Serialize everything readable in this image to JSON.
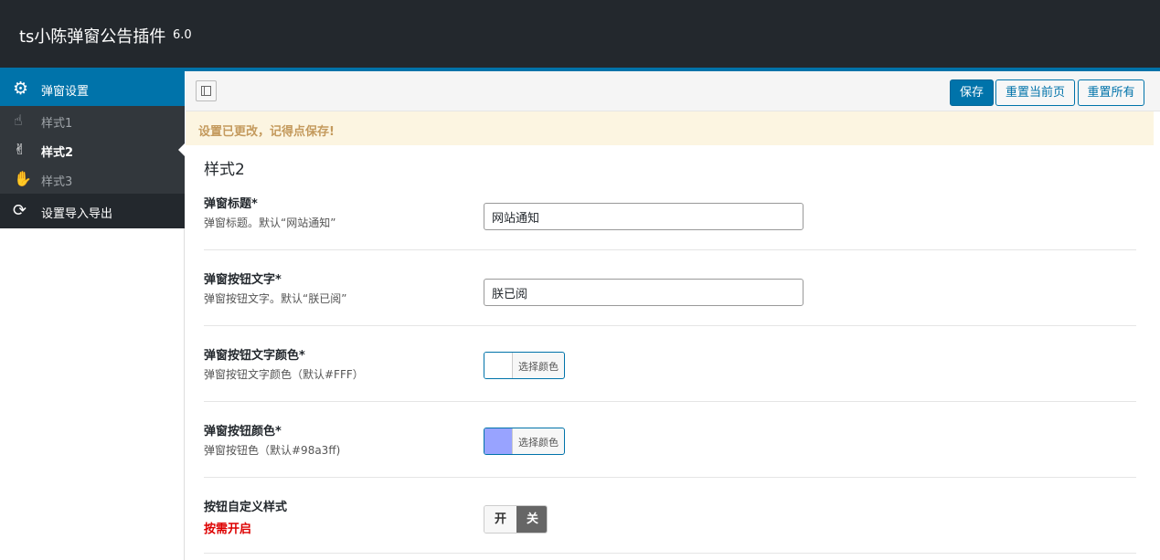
{
  "header": {
    "title": "ts小陈弹窗公告插件",
    "version": "6.0"
  },
  "sidebar": {
    "main": {
      "label": "弹窗设置",
      "icon": "gear-icon"
    },
    "items": [
      {
        "label": "样式1",
        "icon": "hand-pointer-icon",
        "active": false
      },
      {
        "label": "样式2",
        "icon": "hand-peace-icon",
        "active": true
      },
      {
        "label": "样式3",
        "icon": "hand-paper-icon",
        "active": false
      }
    ],
    "tools": {
      "label": "设置导入导出",
      "icon": "refresh-icon"
    }
  },
  "toolbar": {
    "save_label": "保存",
    "reset_page_label": "重置当前页",
    "reset_all_label": "重置所有"
  },
  "notice": {
    "text": "设置已更改，记得点保存!"
  },
  "section": {
    "title": "样式2"
  },
  "fields": {
    "title": {
      "label": "弹窗标题*",
      "desc": "弹窗标题。默认“网站通知”",
      "value": "网站通知"
    },
    "button_text": {
      "label": "弹窗按钮文字*",
      "desc": "弹窗按钮文字。默认“朕已阅”",
      "value": "朕已阅"
    },
    "button_text_color": {
      "label": "弹窗按钮文字颜色*",
      "desc": "弹窗按钮文字颜色（默认#FFF）",
      "picker_label": "选择颜色",
      "color": "#ffffff"
    },
    "button_color": {
      "label": "弹窗按钮颜色*",
      "desc": "弹窗按钮色（默认#98a3ff)",
      "picker_label": "选择颜色",
      "color": "#98a3ff"
    },
    "custom_style": {
      "label": "按钮自定义样式",
      "desc": "按需开启",
      "on_label": "开",
      "off_label": "关",
      "state": "off"
    }
  },
  "colors": {
    "accent": "#0073aa",
    "header_bg": "#23282d",
    "notice_bg": "#fcf5e1"
  }
}
